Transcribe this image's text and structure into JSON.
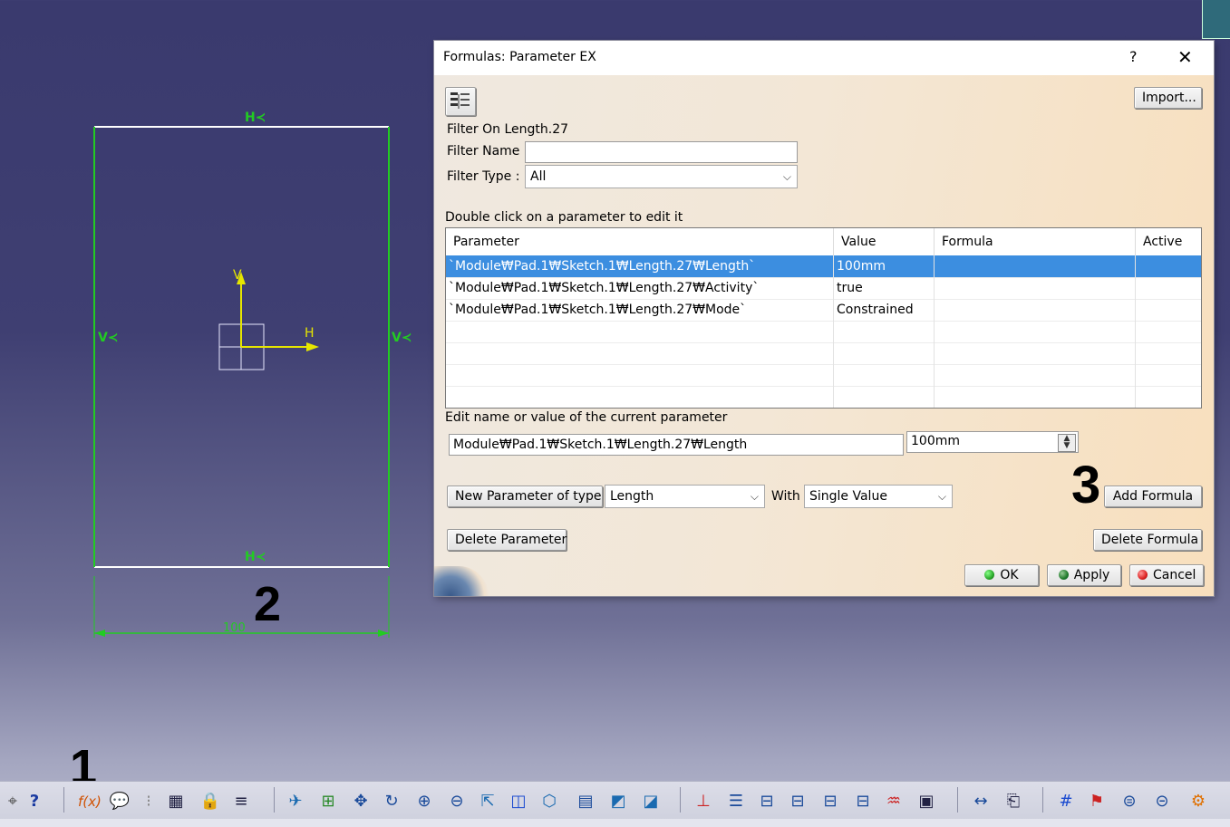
{
  "annotations": {
    "step1": "1",
    "step2": "2",
    "step3": "3"
  },
  "sketch": {
    "constraint_top": "H≺",
    "constraint_bottom": "H≺",
    "constraint_left": "V≺",
    "constraint_right": "V≺",
    "axis_v": "V",
    "axis_h": "H",
    "dimension": "100"
  },
  "dialog": {
    "title": "Formulas: Parameter EX",
    "help": "?",
    "close": "✕",
    "import_label": "Import...",
    "filter_on": "Filter On Length.27",
    "filter_name_label": "Filter Name :",
    "filter_name_value": "",
    "filter_type_label": "Filter Type :",
    "filter_type_value": "All",
    "table_caption": "Double click on a parameter to edit it",
    "columns": [
      "Parameter",
      "Value",
      "Formula",
      "Active"
    ],
    "rows": [
      {
        "parameter": "`Module₩Pad.1₩Sketch.1₩Length.27₩Length`",
        "value": "100mm",
        "formula": "",
        "active": ""
      },
      {
        "parameter": "`Module₩Pad.1₩Sketch.1₩Length.27₩Activity`",
        "value": "true",
        "formula": "",
        "active": ""
      },
      {
        "parameter": "`Module₩Pad.1₩Sketch.1₩Length.27₩Mode`",
        "value": "Constrained",
        "formula": "",
        "active": ""
      }
    ],
    "edit_caption": "Edit name or value of the current parameter",
    "edit_name_value": "Module₩Pad.1₩Sketch.1₩Length.27₩Length",
    "edit_value": "100mm",
    "new_param_label": "New Parameter of type",
    "param_type_value": "Length",
    "with_label": "With",
    "with_value": "Single Value",
    "add_formula_label": "Add Formula",
    "delete_parameter_label": "Delete Parameter",
    "delete_formula_label": "Delete Formula",
    "ok_label": "OK",
    "apply_label": "Apply",
    "cancel_label": "Cancel"
  },
  "colors": {
    "selection": "#3c8ee0",
    "sketch_line": "#22cc22",
    "axis": "#e6e600",
    "ok_dot": "#2aa82a",
    "apply_dot": "#1f7a2a",
    "cancel_dot": "#d22"
  },
  "toolbar_icons": [
    "help-icon",
    "formula-icon",
    "knowledge-advisor-icon",
    "table-icon",
    "lock-icon",
    "law-icon",
    "fly-icon",
    "fit-all-icon",
    "pan-icon",
    "rotate-icon",
    "zoom-in-icon",
    "zoom-out-icon",
    "normal-view-icon",
    "multi-view-icon",
    "iso-view-icon",
    "shading-icon",
    "hide-show-icon",
    "swap-visible-icon",
    "constraint-icon",
    "sketch-analysis-icon",
    "measure-icon",
    "grid-icon",
    "snap-icon",
    "surface-icon",
    "analysis-icon"
  ]
}
